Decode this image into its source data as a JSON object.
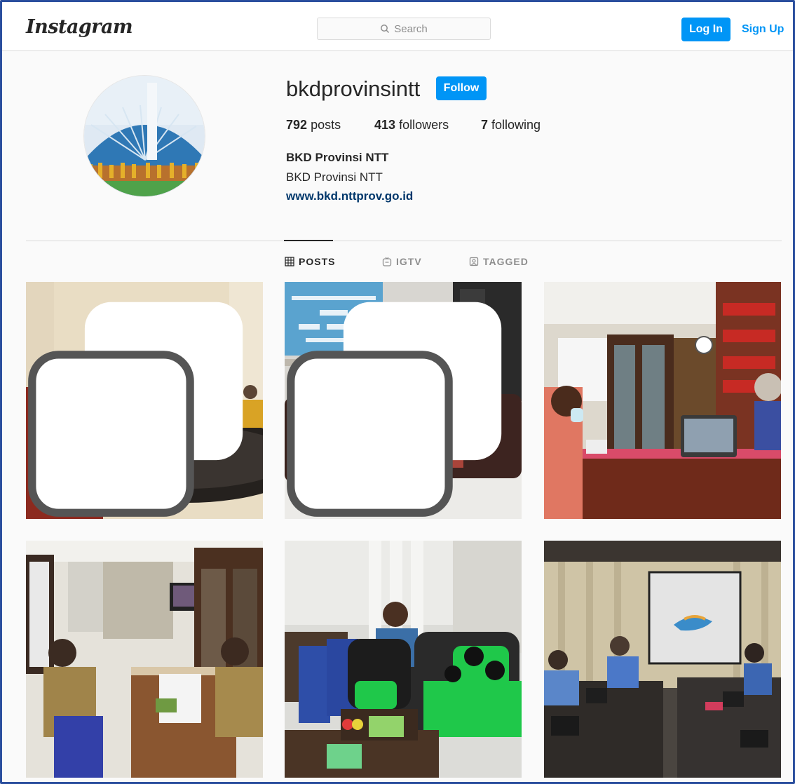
{
  "header": {
    "logo": "Instagram",
    "search_placeholder": "Search",
    "login_label": "Log In",
    "signup_label": "Sign Up"
  },
  "profile": {
    "username": "bkdprovinsintt",
    "follow_label": "Follow",
    "posts_count": "792",
    "posts_label": "posts",
    "followers_count": "413",
    "followers_label": "followers",
    "following_count": "7",
    "following_label": "following",
    "full_name": "BKD Provinsi NTT",
    "bio": "BKD Provinsi NTT",
    "website": "www.bkd.nttprov.go.id"
  },
  "tabs": [
    {
      "label": "POSTS",
      "icon": "grid-icon",
      "active": true
    },
    {
      "label": "IGTV",
      "icon": "igtv-icon",
      "active": false
    },
    {
      "label": "TAGGED",
      "icon": "tagged-icon",
      "active": false
    }
  ],
  "colors": {
    "accent": "#0095f6",
    "link": "#00376b",
    "frame": "#2b4f9e"
  }
}
